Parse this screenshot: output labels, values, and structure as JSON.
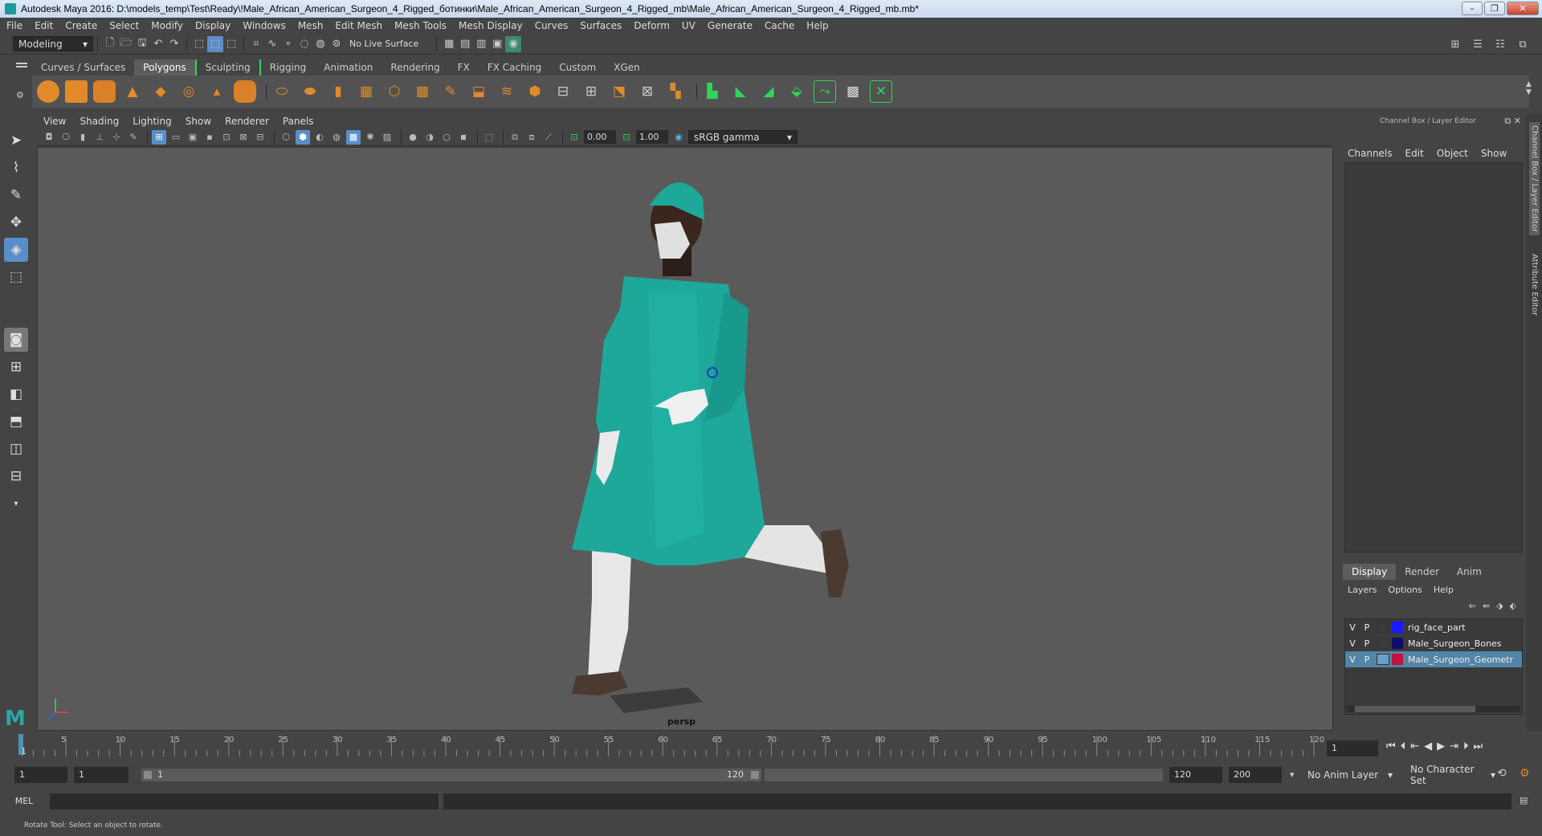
{
  "window": {
    "title": "Autodesk Maya 2016: D:\\models_temp\\Test\\Ready\\!Male_African_American_Surgeon_4_Rigged_ботинки\\Male_African_American_Surgeon_4_Rigged_mb\\Male_African_American_Surgeon_4_Rigged_mb.mb*",
    "min": "–",
    "restore": "❐",
    "close": "✕"
  },
  "menubar": [
    "File",
    "Edit",
    "Create",
    "Select",
    "Modify",
    "Display",
    "Windows",
    "Mesh",
    "Edit Mesh",
    "Mesh Tools",
    "Mesh Display",
    "Curves",
    "Surfaces",
    "Deform",
    "UV",
    "Generate",
    "Cache",
    "Help"
  ],
  "statusline": {
    "mode": "Modeling",
    "live_surface": "No Live Surface"
  },
  "shelf": {
    "tabs": [
      "Curves / Surfaces",
      "Polygons",
      "Sculpting",
      "Rigging",
      "Animation",
      "Rendering",
      "FX",
      "FX Caching",
      "Custom",
      "XGen"
    ],
    "active": "Polygons"
  },
  "viewport": {
    "menu": [
      "View",
      "Shading",
      "Lighting",
      "Show",
      "Renderer",
      "Panels"
    ],
    "exposure": "0.00",
    "gamma": "1.00",
    "colorspace": "sRGB gamma",
    "camera": "persp"
  },
  "channelbox": {
    "title": "Channel Box / Layer Editor",
    "menu": [
      "Channels",
      "Edit",
      "Object",
      "Show"
    ],
    "layer_tabs": [
      "Display",
      "Render",
      "Anim"
    ],
    "layer_menu": [
      "Layers",
      "Options",
      "Help"
    ],
    "layers": [
      {
        "v": "V",
        "p": "P",
        "name": "rig_face_part",
        "color": "#1a1aff"
      },
      {
        "v": "V",
        "p": "P",
        "name": "Male_Surgeon_Bones",
        "color": "#0f0f6a"
      },
      {
        "v": "V",
        "p": "P",
        "name": "Male_Surgeon_Geometr",
        "color": "#c0143c"
      }
    ],
    "side_tabs": [
      "Channel Box / Layer Editor",
      "Attribute Editor"
    ]
  },
  "timeline": {
    "ticks": [
      "5",
      "10",
      "15",
      "20",
      "25",
      "30",
      "35",
      "40",
      "45",
      "50",
      "55",
      "60",
      "65",
      "70",
      "75",
      "80",
      "85",
      "90",
      "95",
      "100",
      "105",
      "110",
      "115",
      "120"
    ],
    "current_marker": "1",
    "current_frame": "1"
  },
  "range": {
    "start": "1",
    "playback_start": "1",
    "slider_left": "1",
    "slider_right": "120",
    "playback_end": "120",
    "end": "200",
    "anim_layer": "No Anim Layer",
    "char_set": "No Character Set"
  },
  "cmd": {
    "label": "MEL"
  },
  "help": {
    "text": "Rotate Tool: Select an object to rotate."
  },
  "colors": {
    "accent": "#5a8ec8",
    "green": "#2fd65a",
    "scrub": "#50b4e6"
  }
}
